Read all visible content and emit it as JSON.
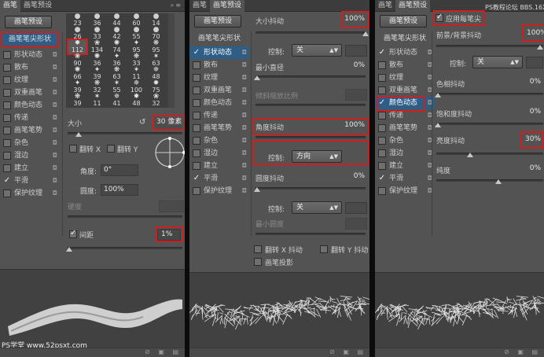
{
  "panel1": {
    "tabs": [
      "画笔",
      "画笔预设"
    ],
    "preset_button": "画笔预设",
    "nav_header": "画笔笔尖形状",
    "nav_items": [
      {
        "label": "形状动态",
        "checked": false
      },
      {
        "label": "散布",
        "checked": false
      },
      {
        "label": "纹理",
        "checked": false
      },
      {
        "label": "双重画笔",
        "checked": false
      },
      {
        "label": "颜色动态",
        "checked": false
      },
      {
        "label": "传递",
        "checked": false
      },
      {
        "label": "画笔笔势",
        "checked": false
      },
      {
        "label": "杂色",
        "checked": false
      },
      {
        "label": "湿边",
        "checked": false
      },
      {
        "label": "建立",
        "checked": false
      },
      {
        "label": "平滑",
        "checked": true
      },
      {
        "label": "保护纹理",
        "checked": false
      }
    ],
    "brush_rows": [
      [
        "23",
        "36",
        "44",
        "60",
        "14"
      ],
      [
        "26",
        "33",
        "42",
        "55",
        "70"
      ],
      [
        "112",
        "134",
        "74",
        "95",
        "95"
      ],
      [
        "90",
        "36",
        "36",
        "33",
        "63"
      ],
      [
        "66",
        "39",
        "63",
        "11",
        "48"
      ],
      [
        "39",
        "32",
        "55",
        "100",
        "75"
      ],
      [
        "39",
        "11",
        "41",
        "48",
        "32"
      ]
    ],
    "selected_brush": "112",
    "size_label": "大小",
    "size_value": "30 像素",
    "flip_x": "翻转 X",
    "flip_y": "翻转 Y",
    "angle_label": "角度:",
    "angle_value": "0°",
    "roundness_label": "圆度:",
    "roundness_value": "100%",
    "hardness_label": "硬度",
    "spacing_label": "间距",
    "spacing_checked": true,
    "spacing_value": "1%",
    "watermark": "PS学堂 www.52psxt.com"
  },
  "panel2": {
    "tabs": [
      "画笔",
      "画笔预设"
    ],
    "preset_button": "画笔预设",
    "nav_header": "画笔笔尖形状",
    "nav_items": [
      {
        "label": "形状动态",
        "checked": true,
        "selected": true
      },
      {
        "label": "散布",
        "checked": false
      },
      {
        "label": "纹理",
        "checked": false
      },
      {
        "label": "双重画笔",
        "checked": false
      },
      {
        "label": "颜色动态",
        "checked": false
      },
      {
        "label": "传递",
        "checked": false
      },
      {
        "label": "画笔笔势",
        "checked": false
      },
      {
        "label": "杂色",
        "checked": false
      },
      {
        "label": "湿边",
        "checked": false
      },
      {
        "label": "建立",
        "checked": false
      },
      {
        "label": "平滑",
        "checked": true
      },
      {
        "label": "保护纹理",
        "checked": false
      }
    ],
    "size_jitter_label": "大小抖动",
    "size_jitter_value": "100%",
    "control_label": "控制:",
    "control1_value": "关",
    "min_diameter_label": "最小直径",
    "min_diameter_value": "0%",
    "tilt_scale_label": "倾斜缩放比例",
    "angle_jitter_label": "角度抖动",
    "angle_jitter_value": "100%",
    "control2_value": "方向",
    "roundness_jitter_label": "圆度抖动",
    "roundness_jitter_value": "0%",
    "control3_value": "关",
    "min_roundness_label": "最小圆度",
    "flip_x_jitter": "翻转 X 抖动",
    "flip_y_jitter": "翻转 Y 抖动",
    "brush_projection": "画笔投影"
  },
  "panel3": {
    "tabs": [
      "画笔",
      "画笔预设"
    ],
    "preset_button": "画笔预设",
    "nav_header": "画笔笔尖形状",
    "nav_items": [
      {
        "label": "形状动态",
        "checked": true
      },
      {
        "label": "散布",
        "checked": false
      },
      {
        "label": "纹理",
        "checked": false
      },
      {
        "label": "双重画笔",
        "checked": false
      },
      {
        "label": "颜色动态",
        "checked": true,
        "selected": true
      },
      {
        "label": "传递",
        "checked": false
      },
      {
        "label": "画笔笔势",
        "checked": false
      },
      {
        "label": "杂色",
        "checked": false
      },
      {
        "label": "湿边",
        "checked": false
      },
      {
        "label": "建立",
        "checked": false
      },
      {
        "label": "平滑",
        "checked": true
      },
      {
        "label": "保护纹理",
        "checked": false
      }
    ],
    "apply_per_tip": "应用每笔尖",
    "watermark": "PS教程论坛 BBS.16XX8.COM",
    "fg_bg_jitter_label": "前景/背景抖动",
    "fg_bg_jitter_value": "100%",
    "control_label": "控制:",
    "control_value": "关",
    "hue_jitter_label": "色相抖动",
    "hue_jitter_value": "0%",
    "saturation_jitter_label": "饱和度抖动",
    "saturation_jitter_value": "0%",
    "brightness_jitter_label": "亮度抖动",
    "brightness_jitter_value": "30%",
    "purity_label": "纯度",
    "purity_value": "0%"
  },
  "colors": {
    "highlight": "#cc1f1f",
    "selection": "#2e5d86",
    "panel": "#535353"
  }
}
